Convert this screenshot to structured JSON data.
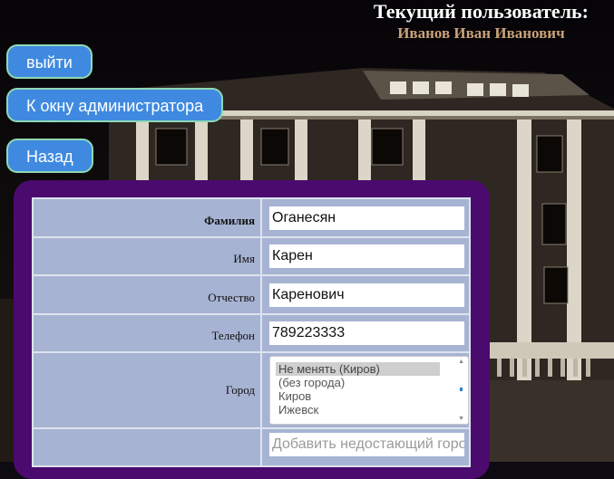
{
  "header": {
    "current_user_label": "Текущий пользователь:",
    "current_user_name": "Иванов Иван Иванович"
  },
  "nav": {
    "logout": "выйти",
    "admin_window": "К окну администратора",
    "back": "Назад"
  },
  "form": {
    "last_name": {
      "label": "Фамилия",
      "value": "Оганесян"
    },
    "first_name": {
      "label": "Имя",
      "value": "Карен"
    },
    "patronymic": {
      "label": "Отчество",
      "value": "Каренович"
    },
    "phone": {
      "label": "Телефон",
      "value": "789223333"
    },
    "city": {
      "label": "Город",
      "options": [
        "Не менять (Киров)",
        "(без города)",
        "Киров",
        "Ижевск"
      ],
      "selected": "Не менять (Киров)"
    },
    "add_city": {
      "placeholder": "Добавить недостающий город"
    }
  },
  "colors": {
    "button_bg": "#3f8ae0",
    "button_border": "#8fd9b3",
    "panel": "#4b0a6e",
    "table_cell": "#a7b3d3",
    "username": "#c9a27a"
  }
}
